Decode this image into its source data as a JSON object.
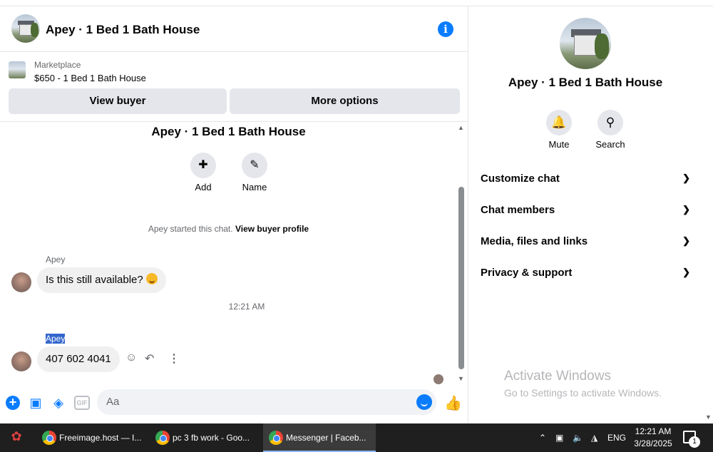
{
  "header": {
    "title": "Apey · 1 Bed 1 Bath House",
    "info_icon": "info-icon"
  },
  "marketplace": {
    "label": "Marketplace",
    "listing": "$650 - 1 Bed 1 Bath House",
    "view_buyer": "View buyer",
    "more_options": "More options"
  },
  "conversation": {
    "title": "Apey · 1 Bed 1 Bath House",
    "add_label": "Add",
    "name_label": "Name",
    "started_text": "Apey started this chat.",
    "view_profile": "View buyer profile",
    "messages": [
      {
        "sender": "Apey",
        "text": "Is this still available?",
        "has_emoji": true
      },
      {
        "sender": "Apey",
        "text": "407 602 4041",
        "has_emoji": false
      }
    ],
    "timestamp": "12:21 AM"
  },
  "composer": {
    "placeholder": "Aa",
    "gif": "GIF"
  },
  "sidebar": {
    "name": "Apey · 1 Bed 1 Bath House",
    "mute": "Mute",
    "search": "Search",
    "sections": [
      "Customize chat",
      "Chat members",
      "Media, files and links",
      "Privacy & support"
    ]
  },
  "watermark": {
    "line1": "Activate Windows",
    "line2": "Go to Settings to activate Windows."
  },
  "taskbar": {
    "tasks": [
      "Freeimage.host — I...",
      "pc 3 fb work - Goo...",
      "Messenger | Faceb..."
    ],
    "lang": "ENG",
    "time": "12:21 AM",
    "date": "3/28/2025",
    "notifications": "1"
  },
  "colors": {
    "accent": "#0a7cff",
    "bubble": "#f0f0f0",
    "button": "#e4e6eb",
    "taskbar": "#1f1f1f"
  }
}
